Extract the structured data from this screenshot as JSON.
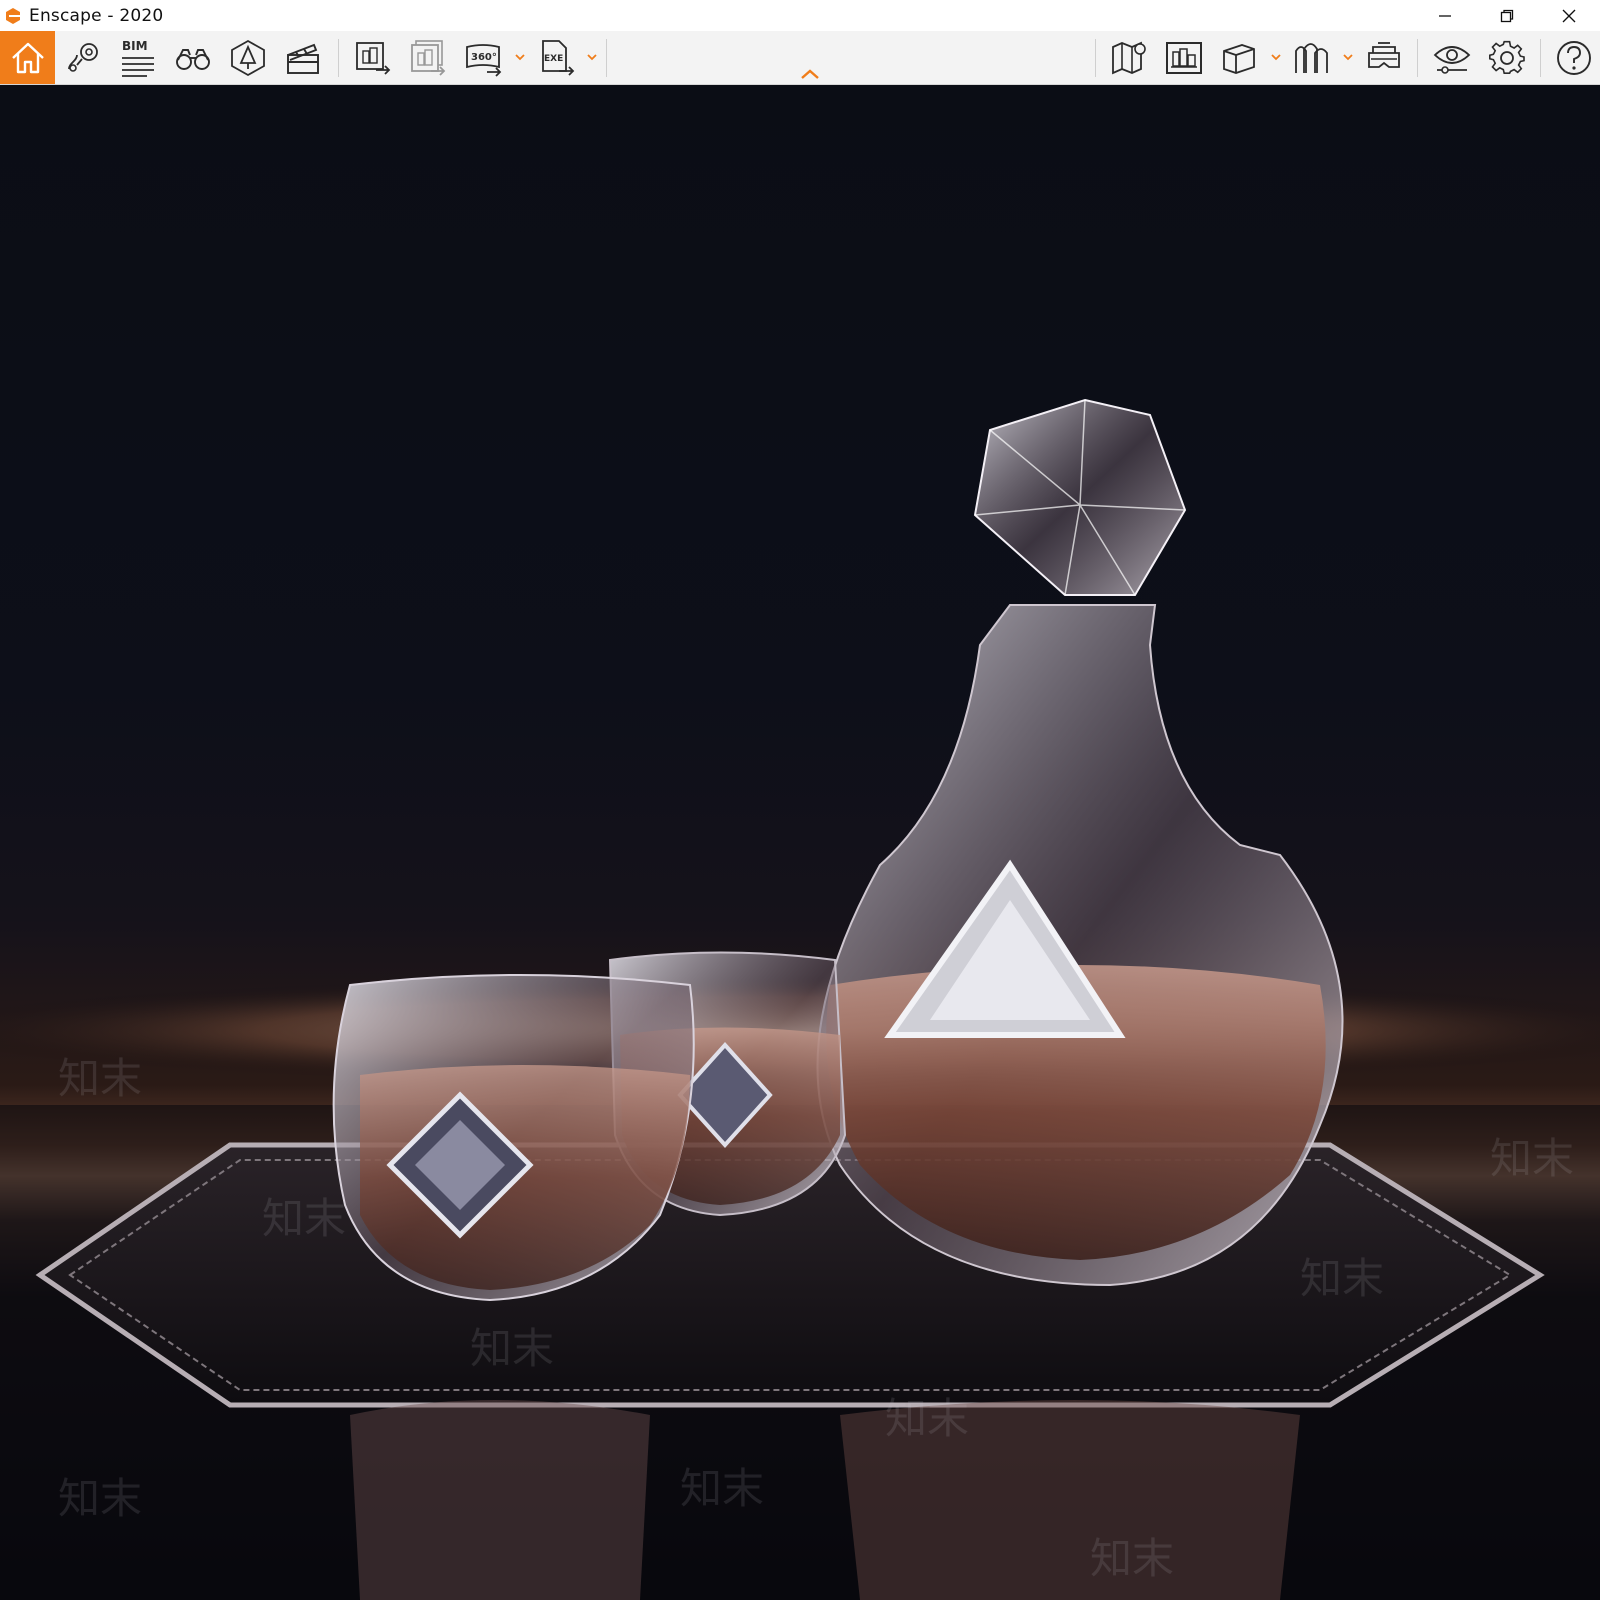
{
  "window": {
    "title": "Enscape - 2020",
    "controls": {
      "minimize": "minimize-icon",
      "restore": "restore-icon",
      "close": "close-icon"
    }
  },
  "toolbar": {
    "bim_label": "BIM",
    "tools_left": [
      {
        "name": "home",
        "icon": "home-icon"
      },
      {
        "name": "views",
        "icon": "location-pin-icon"
      },
      {
        "name": "bim-info",
        "icon": "bim-list-icon"
      },
      {
        "name": "binoculars",
        "icon": "binoculars-icon"
      },
      {
        "name": "asset-library",
        "icon": "tree-icon"
      },
      {
        "name": "video-editor",
        "icon": "clapperboard-icon"
      },
      {
        "name": "render-screenshot",
        "icon": "screenshot-export-icon"
      },
      {
        "name": "batch-render",
        "icon": "batch-export-icon"
      },
      {
        "name": "panorama-360",
        "icon": "panorama-360-icon"
      },
      {
        "name": "export-exe",
        "icon": "export-exe-icon"
      }
    ],
    "panorama_label": "360°",
    "exe_label": "EXE",
    "tools_right": [
      {
        "name": "map",
        "icon": "map-icon"
      },
      {
        "name": "visual-settings",
        "icon": "sun-panel-icon"
      },
      {
        "name": "cube-view",
        "icon": "cube-icon"
      },
      {
        "name": "walk-mode",
        "icon": "people-icon"
      },
      {
        "name": "vr-headset",
        "icon": "vr-headset-icon"
      },
      {
        "name": "preview",
        "icon": "eye-icon"
      },
      {
        "name": "settings",
        "icon": "gear-icon"
      },
      {
        "name": "help",
        "icon": "help-icon"
      }
    ]
  },
  "colors": {
    "accent": "#f07d1a",
    "toolbar_bg": "#f3f3f3",
    "icon": "#2b2b2b"
  },
  "watermark": {
    "text": "知末"
  }
}
